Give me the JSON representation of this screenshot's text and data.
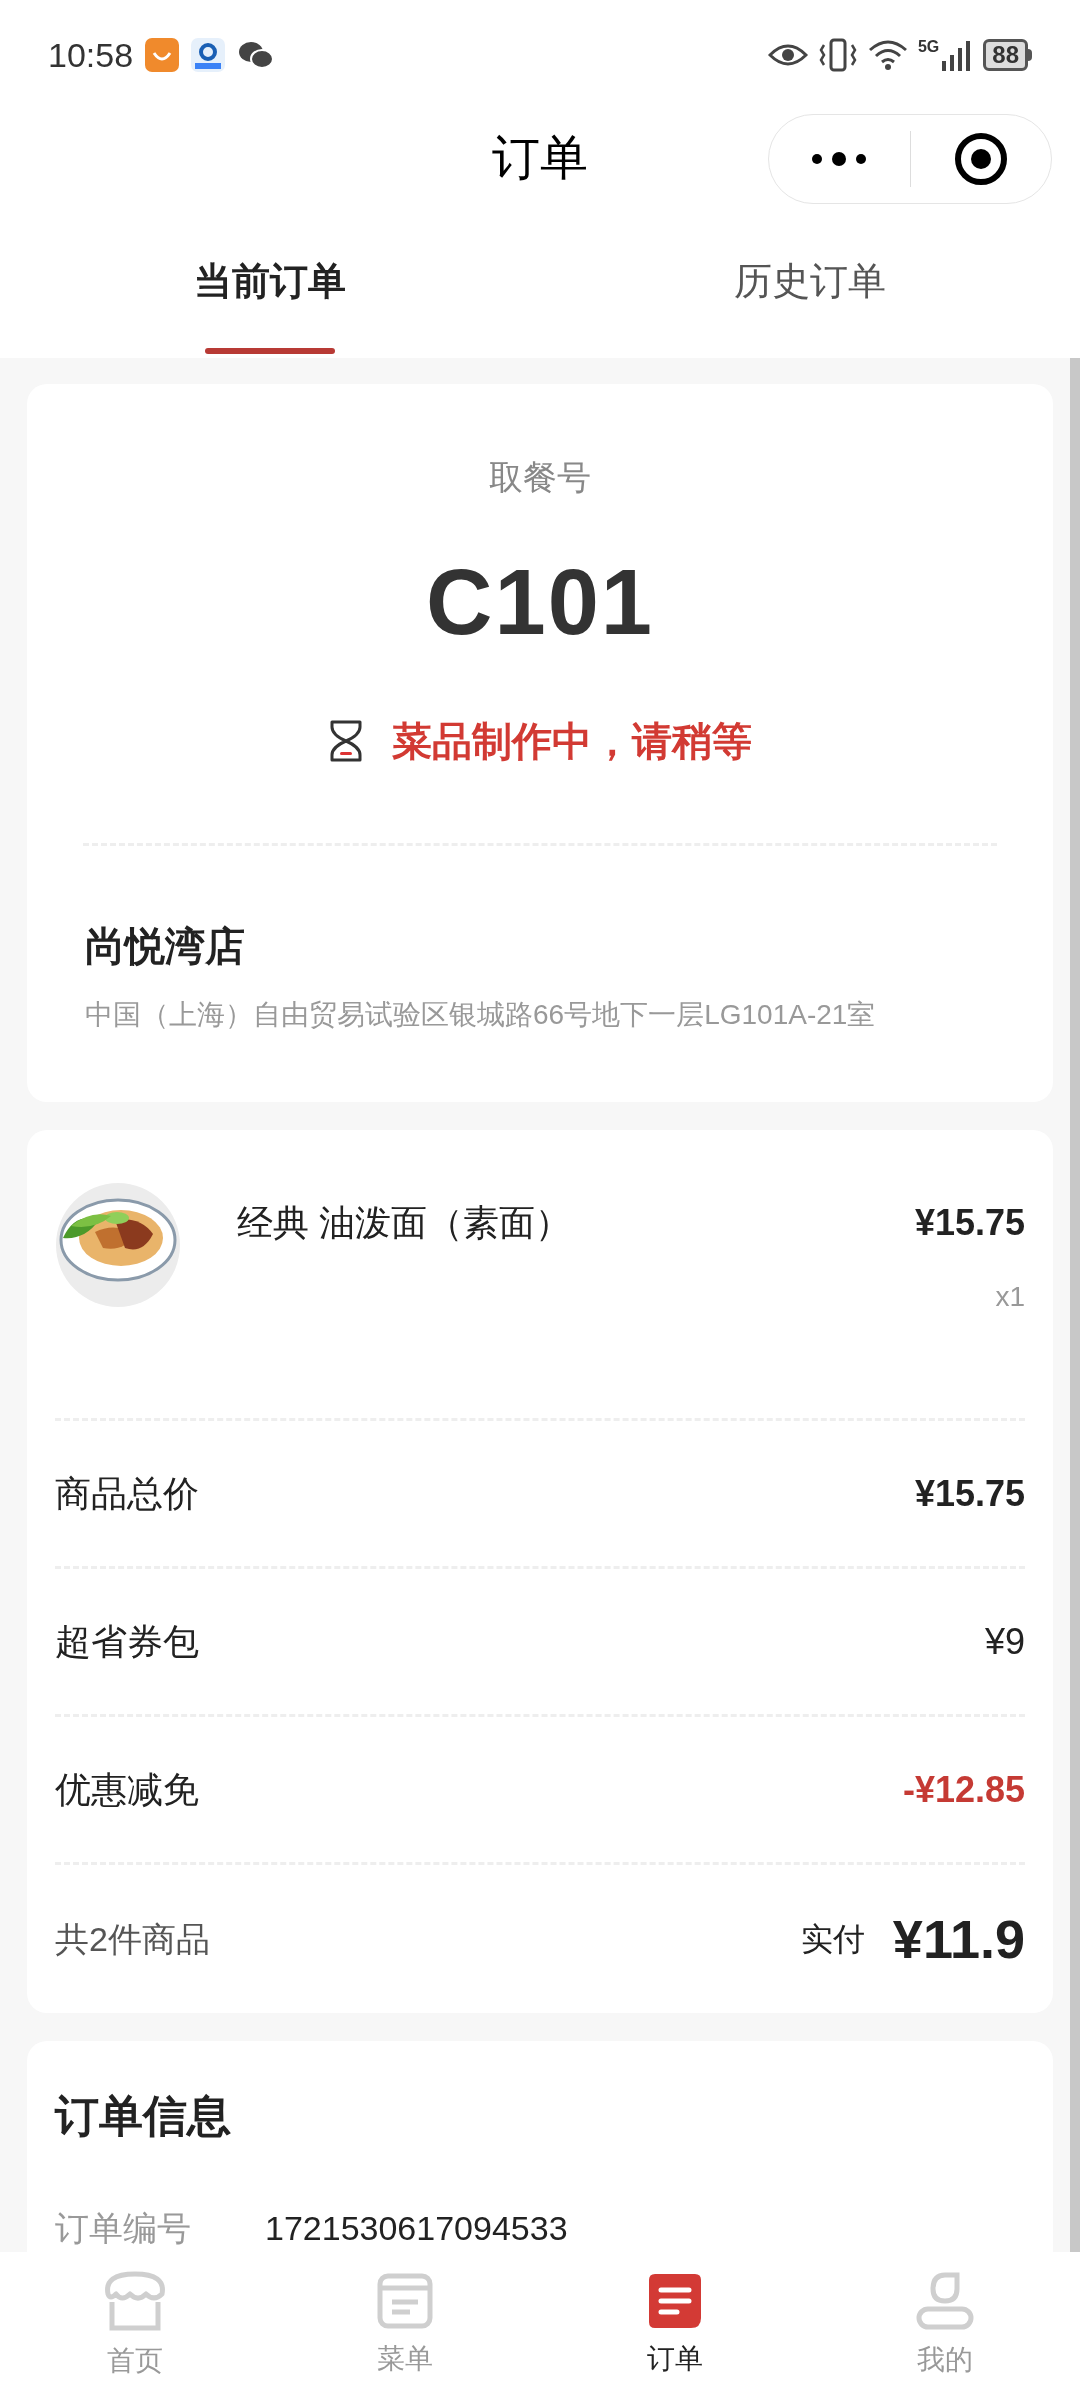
{
  "status_bar": {
    "time": "10:58",
    "network": "5G",
    "battery": "88"
  },
  "header": {
    "title": "订单"
  },
  "tabs": [
    {
      "label": "当前订单",
      "selected": true
    },
    {
      "label": "历史订单",
      "selected": false
    }
  ],
  "pickup": {
    "label": "取餐号",
    "number": "C101",
    "status": "菜品制作中，请稍等"
  },
  "store": {
    "name": "尚悦湾店",
    "address": "中国（上海）自由贸易试验区银城路66号地下一层LG101A-21室"
  },
  "items": [
    {
      "name": "经典 油泼面（素面）",
      "price": "¥15.75",
      "quantity": "x1"
    }
  ],
  "summary": [
    {
      "kind": "total",
      "label": "商品总价",
      "value": "¥15.75"
    },
    {
      "kind": "plain",
      "label": "超省券包",
      "value": "¥9"
    },
    {
      "kind": "discount",
      "label": "优惠减免",
      "value": "-¥12.85"
    },
    {
      "kind": "paid",
      "label": "共2件商品",
      "paid_label": "实付",
      "value": "¥11.9"
    }
  ],
  "order_info": {
    "title": "订单信息",
    "rows": [
      {
        "label": "订单编号",
        "value": "1721530617094533"
      }
    ]
  },
  "bottom_nav": [
    {
      "label": "首页",
      "selected": false
    },
    {
      "label": "菜单",
      "selected": false
    },
    {
      "label": "订单",
      "selected": true
    },
    {
      "label": "我的",
      "selected": false
    }
  ]
}
